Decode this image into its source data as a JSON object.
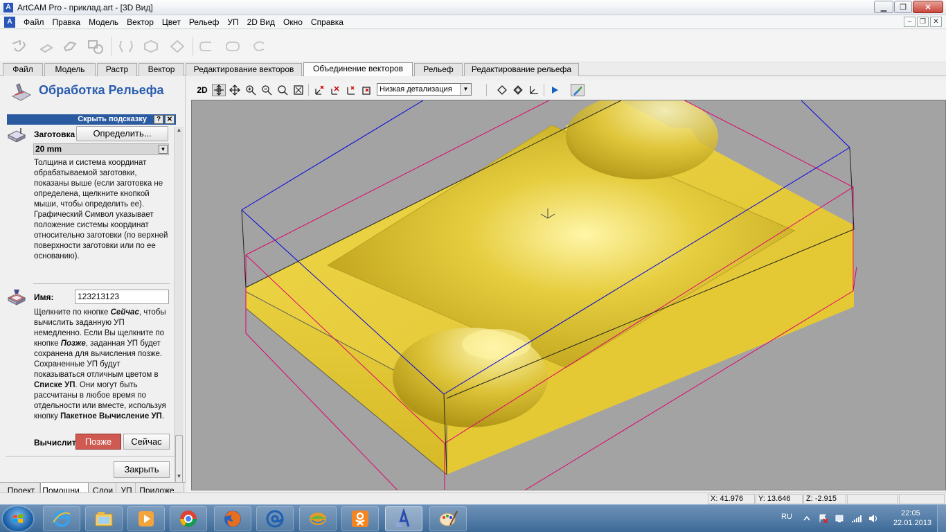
{
  "window": {
    "title": "ArtCAM Pro - приклад.art - [3D Вид]",
    "app_icon": "А"
  },
  "menu": [
    "Файл",
    "Правка",
    "Модель",
    "Вектор",
    "Цвет",
    "Рельеф",
    "УП",
    "2D Вид",
    "Окно",
    "Справка"
  ],
  "main_tabs": [
    "Файл",
    "Модель",
    "Растр",
    "Вектор",
    "Редактирование векторов",
    "Объединение векторов",
    "Рельеф",
    "Редактирование рельефа"
  ],
  "active_main_tab": "Объединение векторов",
  "left_panel": {
    "title": "Обработка Рельефа",
    "hint_bar": "Скрыть подсказку",
    "hint_help": "?",
    "hint_close": "✕",
    "blank_label": "Заготовка",
    "define_button": "Определить...",
    "thickness": "20 mm",
    "blank_help": "Толщина и система координат обрабатываемой заготовки, показаны выше (если заготовка не определена, щелкните кнопкой мыши, чтобы определить ее). Графический Символ указывает положение системы координат относительно заготовки (по верхней поверхности заготовки или по ее основанию).",
    "name_label": "Имя:",
    "name_value": "123213123",
    "calc_help": {
      "p1": "Щелкните по кнопке ",
      "b1": "Сейчас",
      "p2": ", чтобы вычислить заданную УП немедленно. Если Вы щелкните по кнопке ",
      "b2": "Позже",
      "p3": ", заданная УП будет сохранена для вычисления позже. Сохраненные УП будут показываться отличным цветом в ",
      "b3": "Списке УП",
      "p4": ". Они могут быть рассчитаны в любое время по отдельности или вместе, используя кнопку ",
      "b4": "Пакетное Вычисление УП",
      "p5": "."
    },
    "calc_label": "Вычислит",
    "later_button": "Позже",
    "now_button": "Сейчас",
    "close_button": "Закрыть",
    "bottom_tabs": [
      "Проект",
      "Помощни...",
      "Слои",
      "УП",
      "Приложе..."
    ],
    "active_bottom_tab": "Помощни..."
  },
  "view_toolbar": {
    "mode_2d": "2D",
    "detail_level": "Низкая детализация"
  },
  "status": {
    "x": "X: 41.976",
    "y": "Y: 13.646",
    "z": "Z: -2.915"
  },
  "taskbar": {
    "language": "RU",
    "time": "22:05",
    "date": "22.01.2013"
  },
  "colors": {
    "panel_title": "#2a5db0",
    "hint_bar": "#2a5aa0",
    "later_button": "#cf5a52",
    "model_yellow": "#e3c637",
    "viewport_bg": "#a3a3a3",
    "blank_box_pink": "#e0006e",
    "bounding_box_blue": "#0000e0"
  }
}
